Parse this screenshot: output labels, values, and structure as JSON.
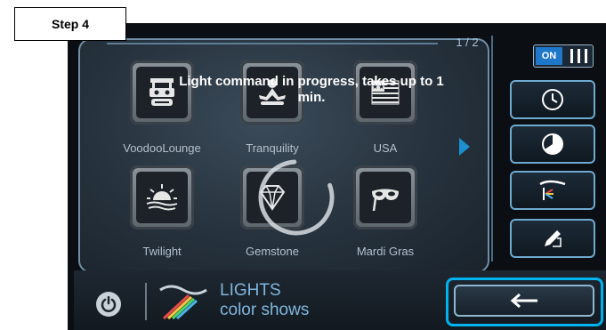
{
  "step_label": "Step 4",
  "page_indicator": "1 / 2",
  "status_message": "Light command in progress, takes up to 1 min.",
  "power_switch": {
    "on_label": "ON"
  },
  "scenes": [
    {
      "label": "VoodooLounge",
      "icon": "tiki-icon"
    },
    {
      "label": "Tranquility",
      "icon": "meditation-icon"
    },
    {
      "label": "USA",
      "icon": "flag-icon"
    },
    {
      "label": "Twilight",
      "icon": "sunset-icon"
    },
    {
      "label": "Gemstone",
      "icon": "diamond-icon"
    },
    {
      "label": "Mardi Gras",
      "icon": "mask-icon"
    }
  ],
  "footer": {
    "title": "LIGHTS",
    "subtitle": "color shows"
  },
  "colors": {
    "accent": "#00b2ee",
    "label_text": "#7fb6de"
  }
}
